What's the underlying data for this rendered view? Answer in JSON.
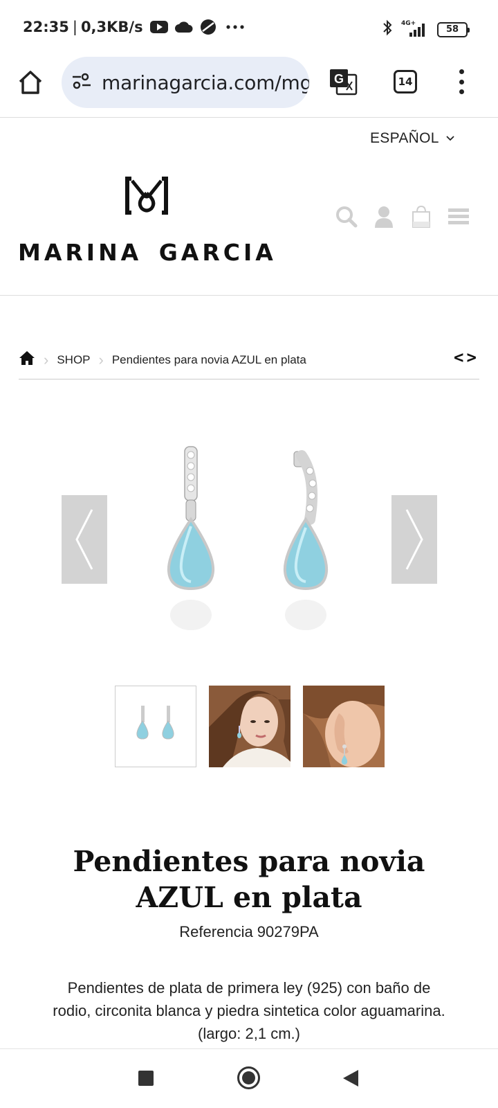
{
  "status_bar": {
    "time": "22:35",
    "speed": "0,3KB/s",
    "network": "4G+",
    "battery": "58"
  },
  "browser": {
    "url": "marinagarcia.com/mg",
    "tab_count": "14"
  },
  "site": {
    "language": "ESPAÑOL",
    "brand_name": "MARINA GARCIA"
  },
  "breadcrumb": {
    "shop": "SHOP",
    "current": "Pendientes para novia AZUL en plata",
    "prevnext": "<>"
  },
  "product": {
    "title_line1": "Pendientes para novia",
    "title_line2": "AZUL en plata",
    "reference": "Referencia 90279PA",
    "description": "Pendientes de plata de primera ley (925) con baño de rodio, circonita blanca y piedra sintetica color aguamarina. (largo: 2,1 cm.)"
  },
  "colors": {
    "aquamarine": "#8fd0e0",
    "url_bg": "#e8edf7",
    "arrow_bg": "#d3d3d3"
  }
}
